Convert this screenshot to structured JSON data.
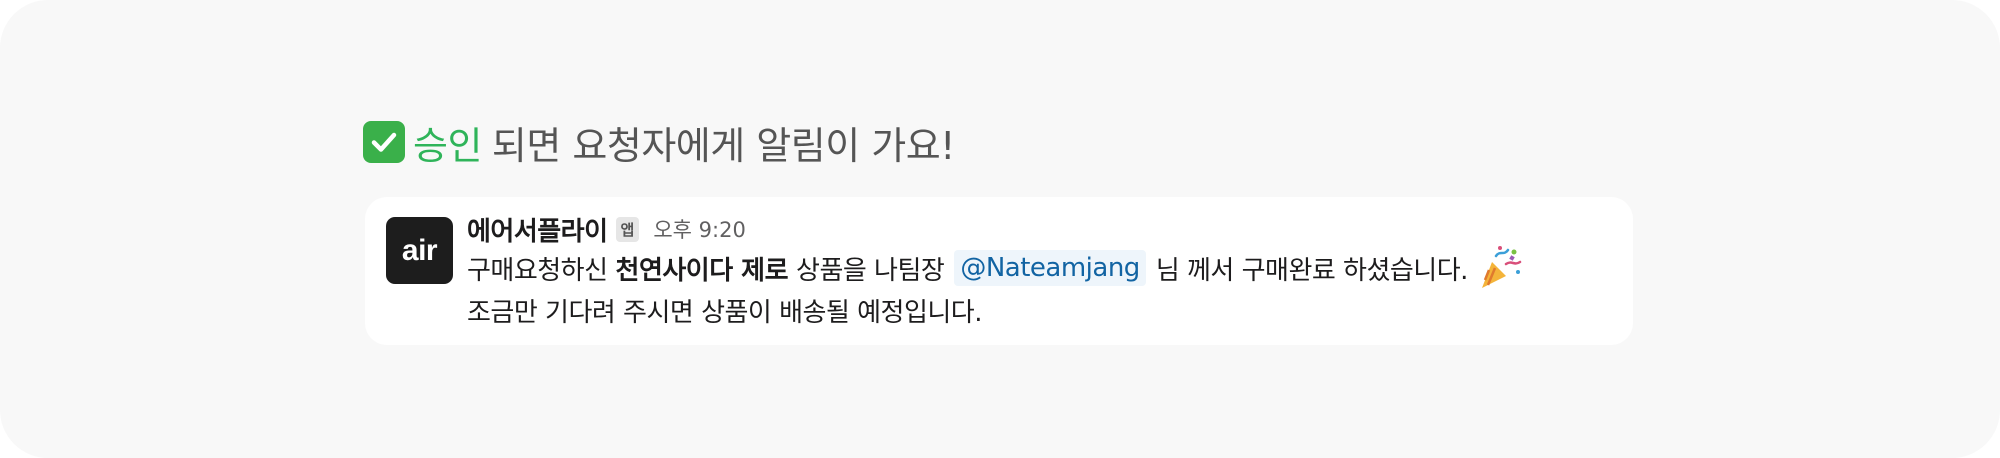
{
  "headline": {
    "accent": "승인",
    "rest": "되면 요청자에게 알림이 가요!",
    "icon": "check-mark-icon"
  },
  "message": {
    "avatar_text": "air",
    "sender": "에어서플라이",
    "badge": "앱",
    "time": "오후 9:20",
    "line1": {
      "part1": "구매요청하신",
      "product": "천연사이다 제로",
      "part2": "상품을 나팀장",
      "mention": "@Nateamjang",
      "part3": "님 께서 구매완료 하셨습니다."
    },
    "line2": "조금만 기다려 주시면 상품이 배송될 예정입니다.",
    "emoji_icon": "party-popper-icon"
  },
  "colors": {
    "accent_green": "#2fb45a",
    "mention_blue": "#1264a3",
    "background": "#f8f8f8"
  }
}
